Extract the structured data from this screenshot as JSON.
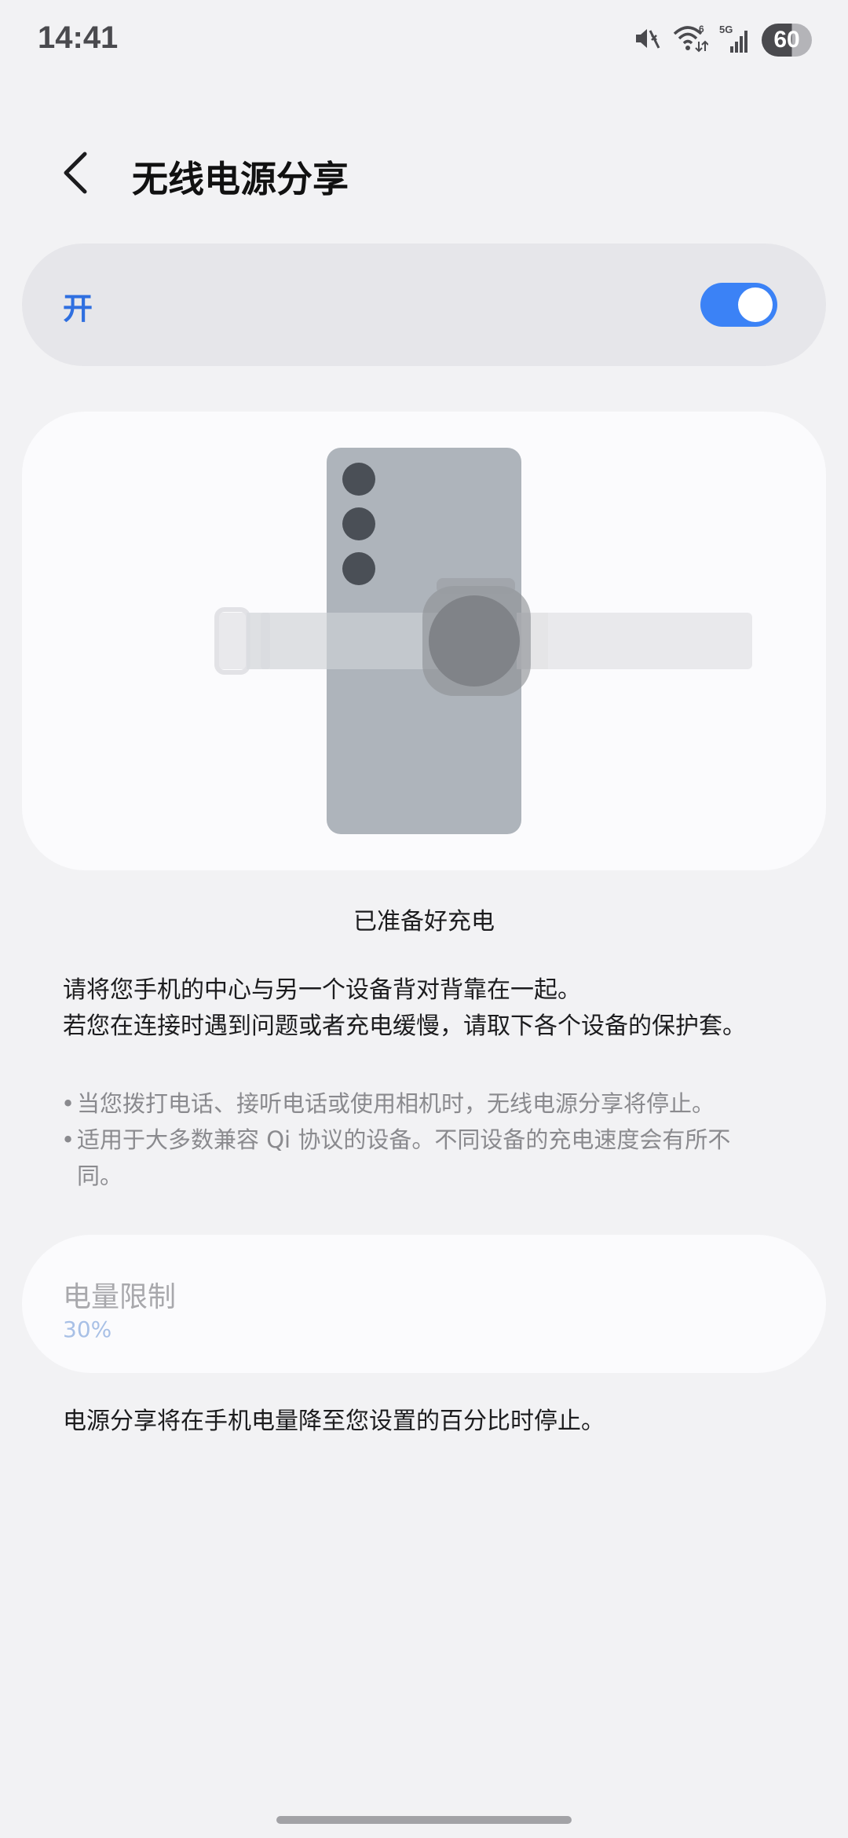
{
  "status_bar": {
    "time": "14:41",
    "battery": "60",
    "icons": [
      "mute-icon",
      "wifi-icon",
      "signal-5g-icon"
    ],
    "network_label": "5G",
    "wifi_label": "6"
  },
  "header": {
    "title": "无线电源分享",
    "back_icon": "chevron-left-icon"
  },
  "toggle": {
    "label": "开",
    "state": "on",
    "accent": "#3b82f6"
  },
  "illustration": {
    "description_icon": "phone-watch-charging-illustration"
  },
  "status_text": "已准备好充电",
  "instructions": {
    "line1": "请将您手机的中心与另一个设备背对背靠在一起。",
    "line2": "若您在连接时遇到问题或者充电缓慢，请取下各个设备的保护套。"
  },
  "notes": {
    "item1": "当您拨打电话、接听电话或使用相机时，无线电源分享将停止。",
    "item2": "适用于大多数兼容 Qi 协议的设备。不同设备的充电速度会有所不同。"
  },
  "battery_limit": {
    "title": "电量限制",
    "value": "30%",
    "description": "电源分享将在手机电量降至您设置的百分比时停止。"
  }
}
